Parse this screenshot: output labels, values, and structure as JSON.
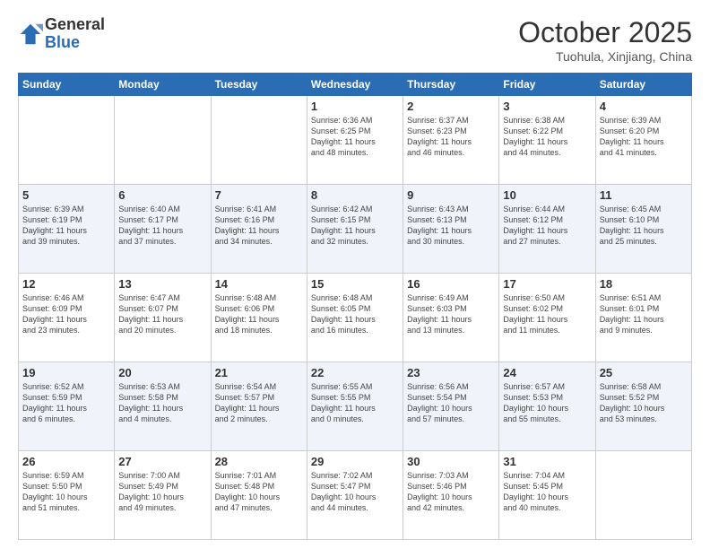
{
  "header": {
    "logo_general": "General",
    "logo_blue": "Blue",
    "month_title": "October 2025",
    "location": "Tuohula, Xinjiang, China"
  },
  "days_of_week": [
    "Sunday",
    "Monday",
    "Tuesday",
    "Wednesday",
    "Thursday",
    "Friday",
    "Saturday"
  ],
  "weeks": [
    {
      "days": [
        {
          "number": "",
          "info": ""
        },
        {
          "number": "",
          "info": ""
        },
        {
          "number": "",
          "info": ""
        },
        {
          "number": "1",
          "info": "Sunrise: 6:36 AM\nSunset: 6:25 PM\nDaylight: 11 hours\nand 48 minutes."
        },
        {
          "number": "2",
          "info": "Sunrise: 6:37 AM\nSunset: 6:23 PM\nDaylight: 11 hours\nand 46 minutes."
        },
        {
          "number": "3",
          "info": "Sunrise: 6:38 AM\nSunset: 6:22 PM\nDaylight: 11 hours\nand 44 minutes."
        },
        {
          "number": "4",
          "info": "Sunrise: 6:39 AM\nSunset: 6:20 PM\nDaylight: 11 hours\nand 41 minutes."
        }
      ]
    },
    {
      "days": [
        {
          "number": "5",
          "info": "Sunrise: 6:39 AM\nSunset: 6:19 PM\nDaylight: 11 hours\nand 39 minutes."
        },
        {
          "number": "6",
          "info": "Sunrise: 6:40 AM\nSunset: 6:17 PM\nDaylight: 11 hours\nand 37 minutes."
        },
        {
          "number": "7",
          "info": "Sunrise: 6:41 AM\nSunset: 6:16 PM\nDaylight: 11 hours\nand 34 minutes."
        },
        {
          "number": "8",
          "info": "Sunrise: 6:42 AM\nSunset: 6:15 PM\nDaylight: 11 hours\nand 32 minutes."
        },
        {
          "number": "9",
          "info": "Sunrise: 6:43 AM\nSunset: 6:13 PM\nDaylight: 11 hours\nand 30 minutes."
        },
        {
          "number": "10",
          "info": "Sunrise: 6:44 AM\nSunset: 6:12 PM\nDaylight: 11 hours\nand 27 minutes."
        },
        {
          "number": "11",
          "info": "Sunrise: 6:45 AM\nSunset: 6:10 PM\nDaylight: 11 hours\nand 25 minutes."
        }
      ]
    },
    {
      "days": [
        {
          "number": "12",
          "info": "Sunrise: 6:46 AM\nSunset: 6:09 PM\nDaylight: 11 hours\nand 23 minutes."
        },
        {
          "number": "13",
          "info": "Sunrise: 6:47 AM\nSunset: 6:07 PM\nDaylight: 11 hours\nand 20 minutes."
        },
        {
          "number": "14",
          "info": "Sunrise: 6:48 AM\nSunset: 6:06 PM\nDaylight: 11 hours\nand 18 minutes."
        },
        {
          "number": "15",
          "info": "Sunrise: 6:48 AM\nSunset: 6:05 PM\nDaylight: 11 hours\nand 16 minutes."
        },
        {
          "number": "16",
          "info": "Sunrise: 6:49 AM\nSunset: 6:03 PM\nDaylight: 11 hours\nand 13 minutes."
        },
        {
          "number": "17",
          "info": "Sunrise: 6:50 AM\nSunset: 6:02 PM\nDaylight: 11 hours\nand 11 minutes."
        },
        {
          "number": "18",
          "info": "Sunrise: 6:51 AM\nSunset: 6:01 PM\nDaylight: 11 hours\nand 9 minutes."
        }
      ]
    },
    {
      "days": [
        {
          "number": "19",
          "info": "Sunrise: 6:52 AM\nSunset: 5:59 PM\nDaylight: 11 hours\nand 6 minutes."
        },
        {
          "number": "20",
          "info": "Sunrise: 6:53 AM\nSunset: 5:58 PM\nDaylight: 11 hours\nand 4 minutes."
        },
        {
          "number": "21",
          "info": "Sunrise: 6:54 AM\nSunset: 5:57 PM\nDaylight: 11 hours\nand 2 minutes."
        },
        {
          "number": "22",
          "info": "Sunrise: 6:55 AM\nSunset: 5:55 PM\nDaylight: 11 hours\nand 0 minutes."
        },
        {
          "number": "23",
          "info": "Sunrise: 6:56 AM\nSunset: 5:54 PM\nDaylight: 10 hours\nand 57 minutes."
        },
        {
          "number": "24",
          "info": "Sunrise: 6:57 AM\nSunset: 5:53 PM\nDaylight: 10 hours\nand 55 minutes."
        },
        {
          "number": "25",
          "info": "Sunrise: 6:58 AM\nSunset: 5:52 PM\nDaylight: 10 hours\nand 53 minutes."
        }
      ]
    },
    {
      "days": [
        {
          "number": "26",
          "info": "Sunrise: 6:59 AM\nSunset: 5:50 PM\nDaylight: 10 hours\nand 51 minutes."
        },
        {
          "number": "27",
          "info": "Sunrise: 7:00 AM\nSunset: 5:49 PM\nDaylight: 10 hours\nand 49 minutes."
        },
        {
          "number": "28",
          "info": "Sunrise: 7:01 AM\nSunset: 5:48 PM\nDaylight: 10 hours\nand 47 minutes."
        },
        {
          "number": "29",
          "info": "Sunrise: 7:02 AM\nSunset: 5:47 PM\nDaylight: 10 hours\nand 44 minutes."
        },
        {
          "number": "30",
          "info": "Sunrise: 7:03 AM\nSunset: 5:46 PM\nDaylight: 10 hours\nand 42 minutes."
        },
        {
          "number": "31",
          "info": "Sunrise: 7:04 AM\nSunset: 5:45 PM\nDaylight: 10 hours\nand 40 minutes."
        },
        {
          "number": "",
          "info": ""
        }
      ]
    }
  ]
}
